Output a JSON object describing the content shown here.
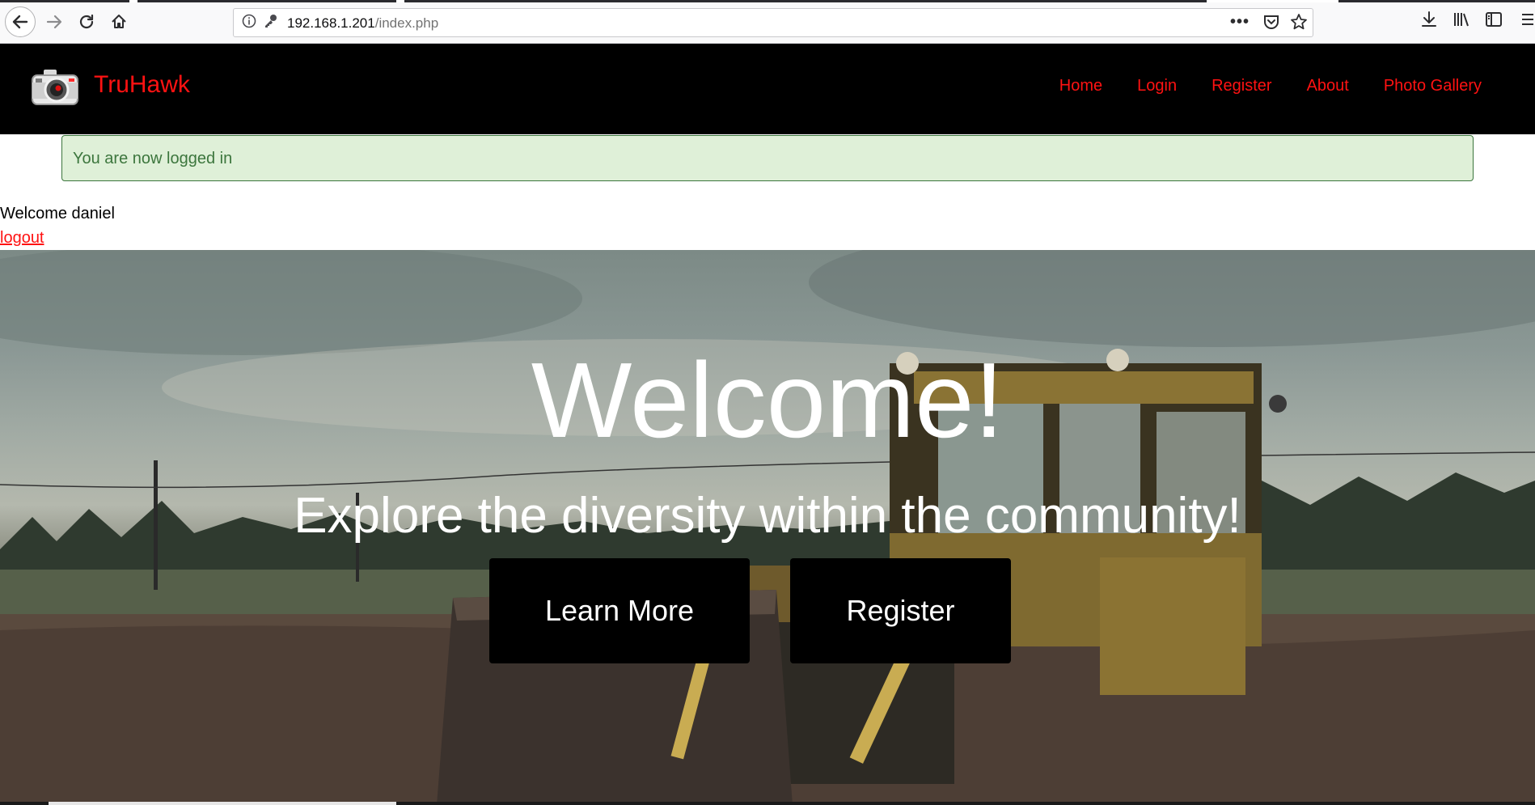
{
  "browser": {
    "url_host": "192.168.1.201",
    "url_path": "/index.php",
    "icons": {
      "back": "back-arrow-icon",
      "forward": "forward-arrow-icon",
      "reload": "reload-icon",
      "home": "home-icon",
      "info": "info-icon",
      "key": "key-icon",
      "more": "more-actions-icon",
      "pocket": "pocket-icon",
      "star": "bookmark-star-icon",
      "download": "download-icon",
      "library": "library-icon",
      "sidebar": "sidebar-icon",
      "menu": "hamburger-menu-icon"
    }
  },
  "site": {
    "brand": "TruHawk",
    "logo_icon": "camera-icon",
    "nav": [
      "Home",
      "Login",
      "Register",
      "About",
      "Photo Gallery"
    ],
    "accent_color": "#ff1212",
    "navbar_color": "#000000"
  },
  "alert": {
    "text": "You are now logged in",
    "background": "#dff0d8",
    "color": "#3c763d"
  },
  "user": {
    "welcome": "Welcome daniel",
    "logout": "logout"
  },
  "hero": {
    "title": "Welcome!",
    "subtitle": "Explore the diversity within the community!",
    "buttons": [
      "Learn More",
      "Register"
    ]
  }
}
